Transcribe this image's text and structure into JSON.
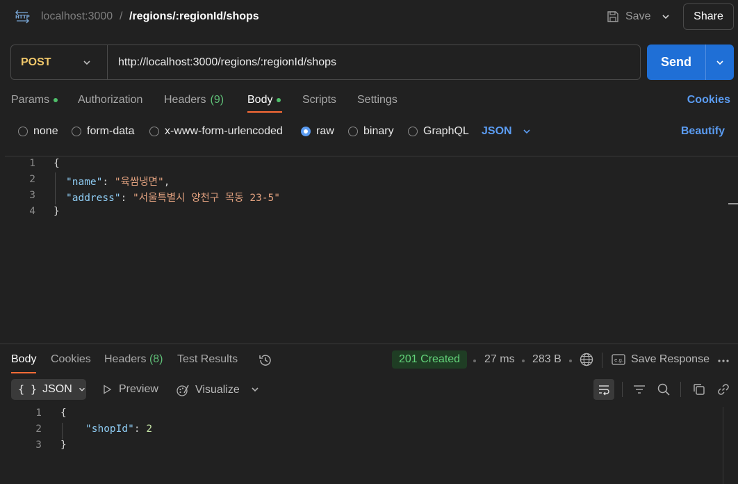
{
  "header": {
    "host": "localhost:3000",
    "separator": "/",
    "path": "/regions/:regionId/shops",
    "save_label": "Save",
    "share_label": "Share"
  },
  "request": {
    "method": "POST",
    "url": "http://localhost:3000/regions/:regionId/shops",
    "send_label": "Send"
  },
  "tabs": [
    {
      "label": "Params",
      "dot": true
    },
    {
      "label": "Authorization"
    },
    {
      "label": "Headers",
      "count": "(9)"
    },
    {
      "label": "Body",
      "dot": true,
      "active": true
    },
    {
      "label": "Scripts"
    },
    {
      "label": "Settings"
    }
  ],
  "cookies_label": "Cookies",
  "body_types": [
    {
      "label": "none",
      "selected": false
    },
    {
      "label": "form-data",
      "selected": false
    },
    {
      "label": "x-www-form-urlencoded",
      "selected": false
    },
    {
      "label": "raw",
      "selected": true
    },
    {
      "label": "binary",
      "selected": false
    },
    {
      "label": "GraphQL",
      "selected": false
    }
  ],
  "raw_language": "JSON",
  "beautify_label": "Beautify",
  "request_body": {
    "line_numbers": [
      "1",
      "2",
      "3",
      "4"
    ],
    "open": "{",
    "key1": "\"name\"",
    "value1": "\"육쌈냉면\"",
    "key2": "\"address\"",
    "value2": "\"서울특별시 양천구 목동 23-5\"",
    "close": "}",
    "colon": ": ",
    "comma": ","
  },
  "response": {
    "tabs": [
      {
        "label": "Body",
        "active": true
      },
      {
        "label": "Cookies"
      },
      {
        "label": "Headers",
        "count": "(8)"
      },
      {
        "label": "Test Results"
      }
    ],
    "status": "201 Created",
    "time": "27 ms",
    "size": "283 B",
    "save_response_label": "Save Response",
    "format": "JSON",
    "preview_label": "Preview",
    "visualize_label": "Visualize",
    "line_numbers": [
      "1",
      "2",
      "3"
    ],
    "open": "{",
    "key": "\"shopId\"",
    "colon": ": ",
    "value": "2",
    "close": "}"
  },
  "icons": [
    "http-icon",
    "save-icon",
    "chevron-down-icon",
    "history-icon",
    "globe-icon",
    "eg-icon",
    "more-icon",
    "play-icon",
    "visualize-icon",
    "wrap-icon",
    "filter-icon",
    "search-icon",
    "copy-icon",
    "link-icon"
  ],
  "colors": {
    "accent": "#1f6fd6",
    "link": "#5b9cf2",
    "method": "#f0c76a",
    "success_bg": "#1f3d24",
    "success_fg": "#63d47a",
    "active_underline": "#ff6c37"
  }
}
